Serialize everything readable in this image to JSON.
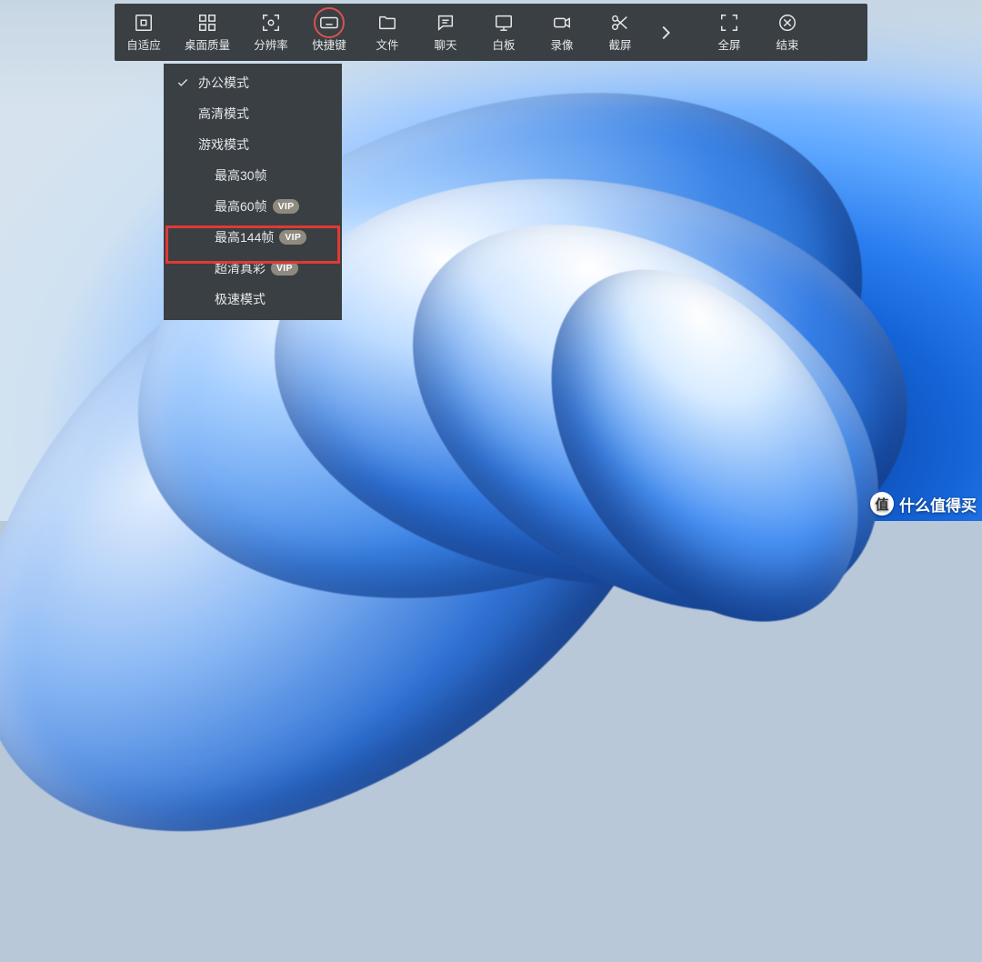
{
  "toolbar": {
    "items": [
      {
        "id": "adaptive",
        "label": "自适应",
        "icon": "fit"
      },
      {
        "id": "desktop-quality",
        "label": "桌面质量",
        "icon": "grid"
      },
      {
        "id": "resolution",
        "label": "分辨率",
        "icon": "focus"
      },
      {
        "id": "shortcut",
        "label": "快捷键",
        "icon": "keyboard",
        "active": true
      },
      {
        "id": "file",
        "label": "文件",
        "icon": "folder"
      },
      {
        "id": "chat",
        "label": "聊天",
        "icon": "chat"
      },
      {
        "id": "whiteboard",
        "label": "白板",
        "icon": "whiteboard"
      },
      {
        "id": "record",
        "label": "录像",
        "icon": "camera"
      },
      {
        "id": "screenshot",
        "label": "截屏",
        "icon": "scissors"
      }
    ],
    "more_icon": "chevron-right",
    "fullscreen_label": "全屏",
    "end_label": "结束"
  },
  "quality_menu": {
    "items": [
      {
        "label": "办公模式",
        "checked": true
      },
      {
        "label": "高清模式"
      },
      {
        "label": "游戏模式"
      },
      {
        "label": "最高30帧",
        "sub": true
      },
      {
        "label": "最高60帧",
        "sub": true,
        "vip": true
      },
      {
        "label": "最高144帧",
        "sub": true,
        "vip": true,
        "highlighted": true
      },
      {
        "label": "超清真彩",
        "sub": true,
        "vip": true
      },
      {
        "label": "极速模式",
        "sub": true
      }
    ],
    "vip_badge_text": "VIP"
  },
  "watermark": {
    "badge": "值",
    "text": "什么值得买"
  }
}
